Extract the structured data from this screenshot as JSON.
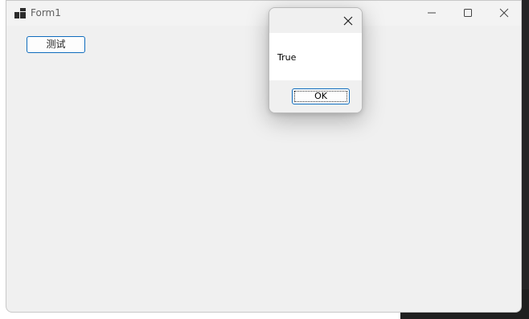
{
  "window": {
    "title": "Form1",
    "icon": "form-app-icon",
    "controls": {
      "minimize_icon": "minimize-icon",
      "maximize_icon": "maximize-icon",
      "close_icon": "close-icon"
    }
  },
  "form": {
    "test_button_label": "测试"
  },
  "dialog": {
    "message": "True",
    "ok_label": "OK",
    "close_icon": "close-icon"
  },
  "colors": {
    "accent": "#0f6cbd",
    "window_bg": "#f0f0f0",
    "dialog_body_bg": "#ffffff"
  }
}
